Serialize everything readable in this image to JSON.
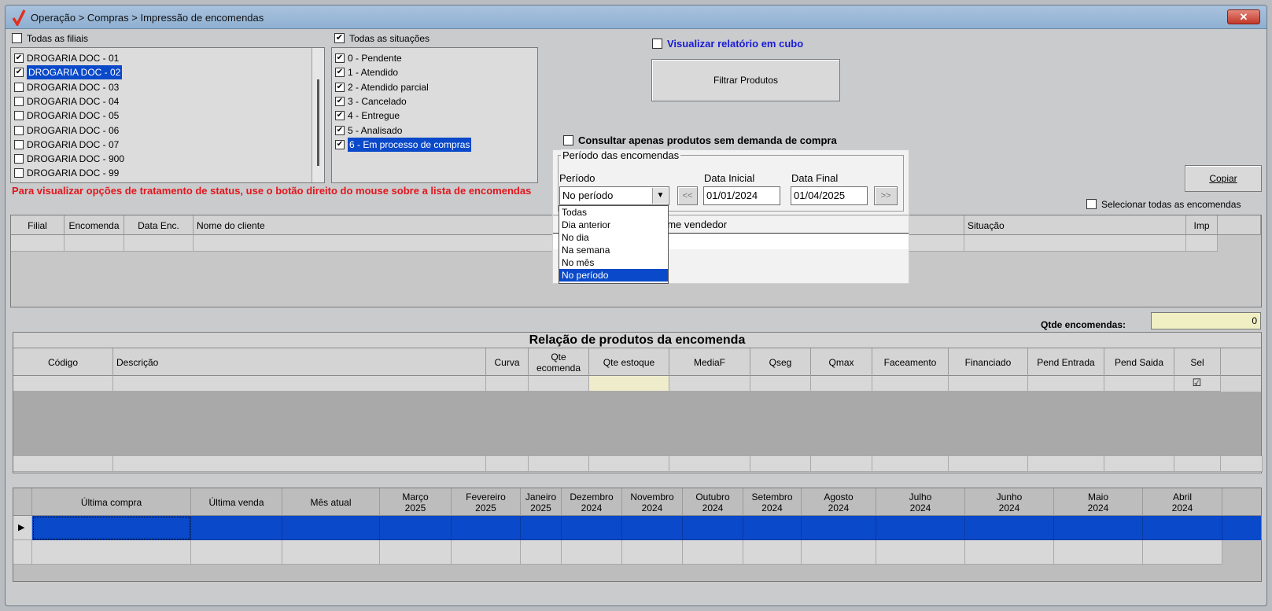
{
  "window": {
    "title": "Operação > Compras > Impressão de encomendas",
    "close": "✕"
  },
  "filiais": {
    "all_label": "Todas as filiais",
    "items": [
      {
        "label": "DROGARIA DOC - 01",
        "checked": true,
        "selected": false
      },
      {
        "label": "DROGARIA DOC - 02",
        "checked": true,
        "selected": true
      },
      {
        "label": "DROGARIA DOC - 03",
        "checked": false,
        "selected": false
      },
      {
        "label": "DROGARIA DOC - 04",
        "checked": false,
        "selected": false
      },
      {
        "label": "DROGARIA DOC - 05",
        "checked": false,
        "selected": false
      },
      {
        "label": "DROGARIA DOC - 06",
        "checked": false,
        "selected": false
      },
      {
        "label": "DROGARIA DOC - 07",
        "checked": false,
        "selected": false
      },
      {
        "label": "DROGARIA DOC - 900",
        "checked": false,
        "selected": false
      },
      {
        "label": "DROGARIA DOC - 99",
        "checked": false,
        "selected": false
      }
    ]
  },
  "situacoes": {
    "all_label": "Todas as situações",
    "items": [
      {
        "label": "0 - Pendente",
        "checked": true,
        "selected": false
      },
      {
        "label": "1 - Atendido",
        "checked": true,
        "selected": false
      },
      {
        "label": "2 - Atendido parcial",
        "checked": true,
        "selected": false
      },
      {
        "label": "3 - Cancelado",
        "checked": true,
        "selected": false
      },
      {
        "label": "4 - Entregue",
        "checked": true,
        "selected": false
      },
      {
        "label": "5 - Analisado",
        "checked": true,
        "selected": false
      },
      {
        "label": "6 - Em processo de compras",
        "checked": true,
        "selected": true
      }
    ]
  },
  "cubo_label": "Visualizar relatório em cubo",
  "filtrar_label": "Filtrar Produtos",
  "demanda_label": "Consultar apenas produtos sem demanda de compra",
  "periodo": {
    "group_label": "Período das encomendas",
    "periodo_label": "Período",
    "value": "No período",
    "data_inicial_label": "Data Inicial",
    "data_inicial": "01/01/2024",
    "data_final_label": "Data Final",
    "data_final": "01/04/2025",
    "prev": "<<",
    "next": ">>",
    "options": [
      "Todas",
      "Dia anterior",
      "No dia",
      "Na semana",
      "No mês",
      "No período"
    ],
    "selected_index": 5
  },
  "copiar_label": "Copiar",
  "selecionar_todas_label": "Selecionar todas as encomendas",
  "hint_text": "Para visualizar opções de tratamento de status, use o botão direito do mouse sobre a lista de encomendas",
  "encomendas_grid": {
    "headers": [
      "Filial",
      "Encomenda",
      "Data Enc.",
      "Nome do cliente",
      "ome vendedor",
      "Situação",
      "Imp"
    ]
  },
  "qtde_label": "Qtde encomendas:",
  "qtde_value": "0",
  "produtos": {
    "title": "Relação de produtos da encomenda",
    "headers": [
      "Código",
      "Descrição",
      "Curva",
      "Qte ecomenda",
      "Qte estoque",
      "MediaF",
      "Qseg",
      "Qmax",
      "Faceamento",
      "Financiado",
      "Pend Entrada",
      "Pend Saida",
      "Sel"
    ],
    "sel_checked": true
  },
  "historico": {
    "headers": [
      "Última compra",
      "Última venda",
      "Mês atual",
      "Março 2025",
      "Fevereiro 2025",
      "Janeiro 2025",
      "Dezembro 2024",
      "Novembro 2024",
      "Outubro 2024",
      "Setembro 2024",
      "Agosto 2024",
      "Julho 2024",
      "Junho 2024",
      "Maio 2024",
      "Abril 2024"
    ]
  }
}
